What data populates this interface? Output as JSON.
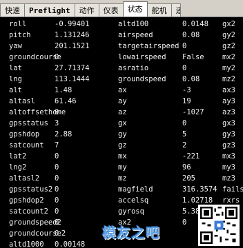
{
  "tabs": [
    {
      "label": "快速",
      "name": "tab-quick",
      "mono": false,
      "active": false
    },
    {
      "label": "Preflight",
      "name": "tab-preflight",
      "mono": true,
      "active": false
    },
    {
      "label": "动作",
      "name": "tab-actions",
      "mono": false,
      "active": false
    },
    {
      "label": "仪表",
      "name": "tab-gauges",
      "mono": false,
      "active": false
    },
    {
      "label": "状态",
      "name": "tab-status",
      "mono": false,
      "active": true
    },
    {
      "label": "舵机",
      "name": "tab-servo",
      "mono": false,
      "active": false
    },
    {
      "label": "遥",
      "name": "tab-telemetry",
      "mono": false,
      "active": false,
      "cut": true
    }
  ],
  "status_rows": [
    [
      "roll",
      "-0.99401",
      "altd100",
      "0.0148",
      "gx2"
    ],
    [
      "pitch",
      "1.131246",
      "airspeed",
      "0.08",
      "gy2"
    ],
    [
      "yaw",
      "201.1521",
      "targetairspeed",
      "0",
      "gz2"
    ],
    [
      "groundcourse",
      "0",
      "lowairspeed",
      "False",
      "mx2"
    ],
    [
      "lat",
      "27.71374",
      "asratio",
      "0",
      "my2"
    ],
    [
      "lng",
      "113.1444",
      "groundspeed",
      "0.08",
      "mz2"
    ],
    [
      "alt",
      "1.48",
      "ax",
      "-3",
      "ax3"
    ],
    [
      "altasl",
      "61.46",
      "ay",
      "19",
      "ay3"
    ],
    [
      "altoffsethome",
      "0",
      "az",
      "-1027",
      "az3"
    ],
    [
      "gpsstatus",
      "3",
      "gx",
      "0",
      "gx3"
    ],
    [
      "gpshdop",
      "2.88",
      "gy",
      "5",
      "gy3"
    ],
    [
      "satcount",
      "7",
      "gz",
      "2",
      "gz3"
    ],
    [
      "lat2",
      "0",
      "mx",
      "-221",
      "mx3"
    ],
    [
      "lng2",
      "0",
      "my",
      "96",
      "my3"
    ],
    [
      "altasl2",
      "0",
      "mz",
      "205",
      "mz3"
    ],
    [
      "gpsstatus2",
      "0",
      "magfield",
      "316.3574",
      "fails"
    ],
    [
      "gpshdop2",
      "0",
      "accelsq",
      "1.02718",
      "rxrs"
    ],
    [
      "satcount2",
      "0",
      "gyrosq",
      "5.385165",
      ""
    ],
    [
      "groundspeed2",
      "0",
      "ax2",
      "0",
      ""
    ],
    [
      "groundcourse2",
      "0",
      "",
      "",
      ""
    ],
    [
      "altd1000",
      "0.00148",
      "",
      "",
      ""
    ]
  ],
  "watermark": {
    "text": "模友之吧"
  },
  "colors": {
    "background": "#000000",
    "text": "#f0f0f0",
    "tabbar": "#d4d0c8"
  }
}
